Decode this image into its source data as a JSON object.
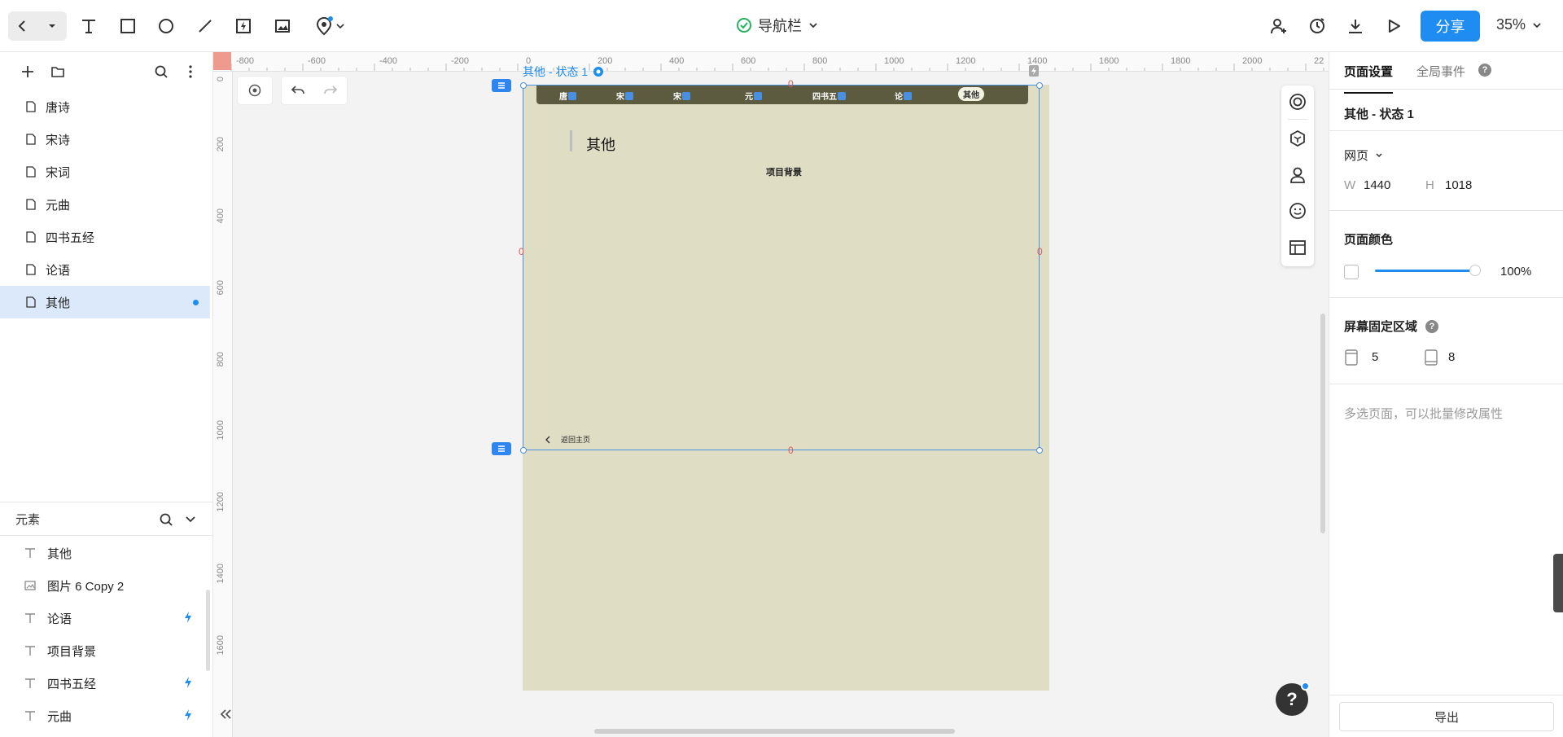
{
  "toolbar": {
    "title": "导航栏",
    "share_label": "分享",
    "zoom": "35%"
  },
  "pages": [
    {
      "label": "唐诗"
    },
    {
      "label": "宋诗"
    },
    {
      "label": "宋词"
    },
    {
      "label": "元曲"
    },
    {
      "label": "四书五经"
    },
    {
      "label": "论语"
    },
    {
      "label": "其他",
      "active": true
    }
  ],
  "elements_panel": {
    "title": "元素",
    "items": [
      {
        "label": "其他",
        "type": "text-icon",
        "interaction": false
      },
      {
        "label": "图片 6 Copy 2",
        "type": "image-icon",
        "interaction": false
      },
      {
        "label": "论语",
        "type": "text-icon",
        "interaction": true
      },
      {
        "label": "项目背景",
        "type": "text-icon",
        "interaction": false
      },
      {
        "label": "四书五经",
        "type": "text-icon",
        "interaction": true
      },
      {
        "label": "元曲",
        "type": "text-icon",
        "interaction": true
      }
    ]
  },
  "rulers": {
    "top": [
      "-800",
      "-600",
      "-400",
      "-200",
      "0",
      "200",
      "400",
      "600",
      "800",
      "1000",
      "1200",
      "1400",
      "1600",
      "1800",
      "2000",
      "22"
    ],
    "left": [
      "0",
      "200",
      "400",
      "600",
      "800",
      "1000",
      "1200",
      "1400",
      "1600"
    ]
  },
  "canvas": {
    "frame_label": "其他 - 状态 1",
    "nav_items": [
      "唐",
      "宋",
      "宋",
      "元",
      "四书五",
      "论"
    ],
    "nav_active": "其他",
    "section_title": "其他",
    "subtitle": "项目背景",
    "back_link": "返回主页",
    "zero_marker": "0",
    "artboard_color": "#dfdec5",
    "navbar_color": "#5c5b40"
  },
  "right_panel": {
    "tab_page_settings": "页面设置",
    "tab_global_events": "全局事件",
    "selected_title": "其他 - 状态 1",
    "page_type": "网页",
    "w_label": "W",
    "w_value": "1440",
    "h_label": "H",
    "h_value": "1018",
    "page_color_title": "页面颜色",
    "opacity": "100%",
    "fixed_area_title": "屏幕固定区域",
    "fixed_top": "5",
    "fixed_bottom": "8",
    "hint": "多选页面，可以批量修改属性",
    "export_label": "导出",
    "help_mark": "?"
  },
  "colors": {
    "accent": "#1e8cf0",
    "selected_row": "#dbe9fb"
  }
}
